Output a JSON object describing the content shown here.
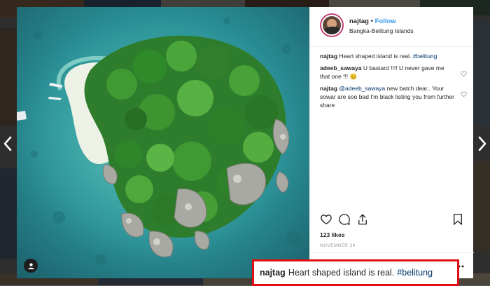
{
  "post": {
    "username": "najtag",
    "separator": "•",
    "follow_label": "Follow",
    "location": "Bangka-Belitung Islands",
    "likes": "123 likes",
    "date": "NOVEMBER 26"
  },
  "comments": [
    {
      "user": "najtag",
      "text": "Heart shaped island is real.",
      "tag": "#belitung",
      "has_heart": false
    },
    {
      "user": "adeeb_sawaya",
      "text": "U bastard !!!! U never gave me that one !!! 😊",
      "tag": "",
      "has_heart": true
    },
    {
      "user": "najtag",
      "mention": "@adeeb_sawaya",
      "text": "new batch dear.. Your sowar are soo bad I'm black listing you from further share",
      "has_heart": true
    }
  ],
  "highlight": {
    "user": "najtag",
    "text": "Heart shaped island is real.",
    "tag": "#belitung"
  },
  "icons": {
    "prev": "chevron-left-icon",
    "next": "chevron-right-icon",
    "like": "heart-icon",
    "comment": "comment-bubble-icon",
    "share": "share-icon",
    "save": "bookmark-icon",
    "more": "more-dots-icon",
    "user_tag": "person-icon"
  },
  "colors": {
    "follow": "#3897f0",
    "hashtag": "#003569",
    "highlight_border": "#e10d12",
    "text": "#262626",
    "muted": "#999999"
  }
}
